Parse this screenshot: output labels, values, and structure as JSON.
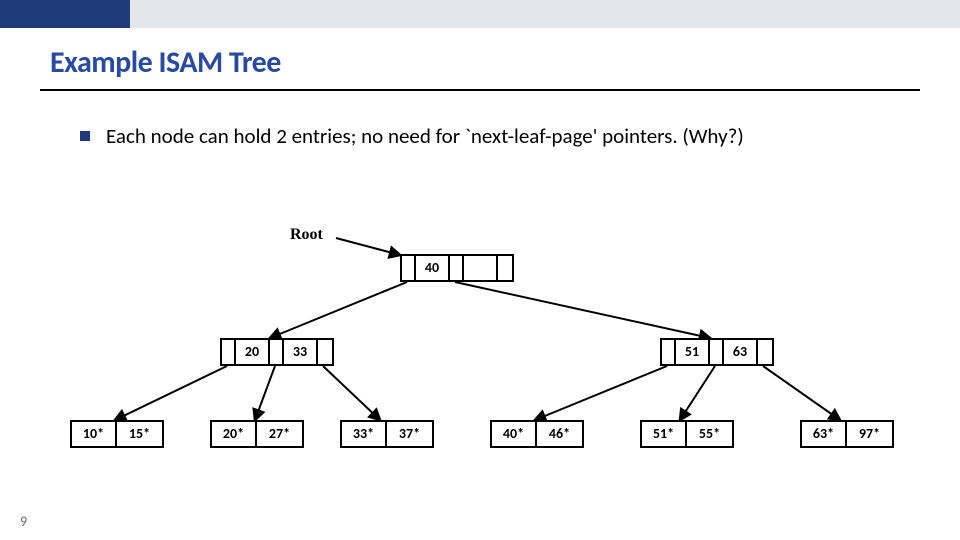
{
  "title": "Example ISAM Tree",
  "bullet_text": "Each node can hold 2 entries; no need for `next-leaf-page' pointers. (Why?)",
  "root_label": "Root",
  "page_number": "9",
  "tree": {
    "root": {
      "keys": [
        "40",
        ""
      ]
    },
    "internal": [
      {
        "keys": [
          "20",
          "33"
        ]
      },
      {
        "keys": [
          "51",
          "63"
        ]
      }
    ],
    "leaves": [
      {
        "keys": [
          "10*",
          "15*"
        ]
      },
      {
        "keys": [
          "20*",
          "27*"
        ]
      },
      {
        "keys": [
          "33*",
          "37*"
        ]
      },
      {
        "keys": [
          "40*",
          "46*"
        ]
      },
      {
        "keys": [
          "51*",
          "55*"
        ]
      },
      {
        "keys": [
          "63*",
          "97*"
        ]
      }
    ]
  }
}
